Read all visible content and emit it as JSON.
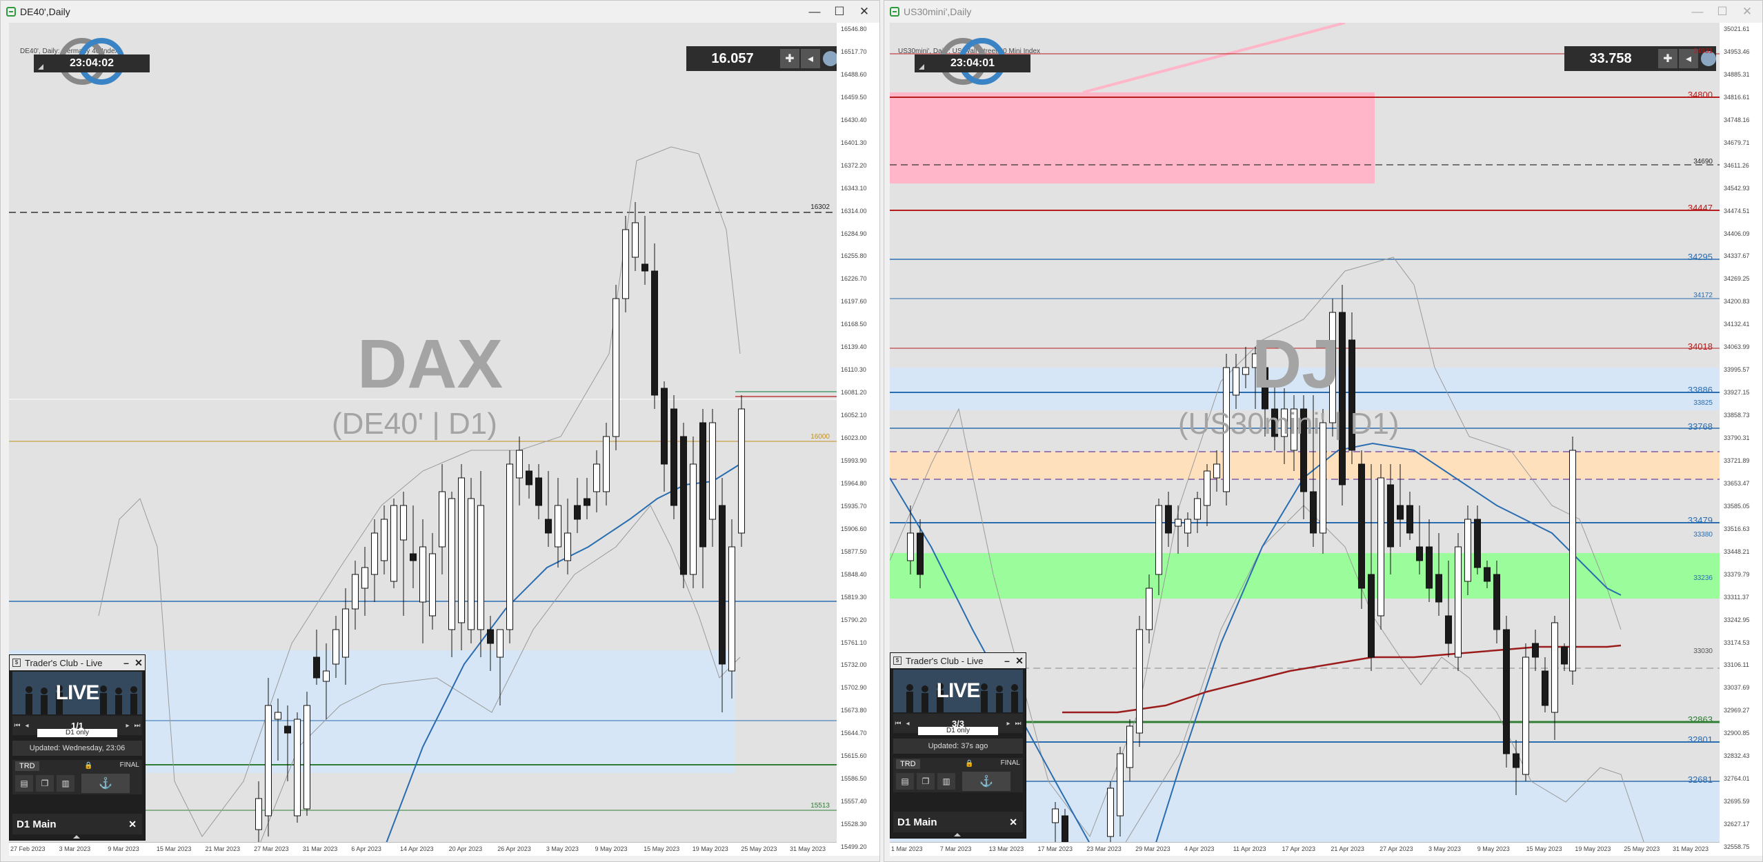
{
  "windows": [
    {
      "title": "DE40',Daily",
      "subtitle": "DE40', Daily:  Germany 40 Index",
      "watermark_main": "DAX",
      "watermark_sub": "(DE40' | D1)",
      "clock": "23:04:02",
      "price_box": "16.057",
      "y_axis_labels": [
        "16546.80",
        "16517.70",
        "16488.60",
        "16459.50",
        "16430.40",
        "16401.30",
        "16372.20",
        "16343.10",
        "16314.00",
        "16284.90",
        "16255.80",
        "16226.70",
        "16197.60",
        "16168.50",
        "16139.40",
        "16110.30",
        "16081.20",
        "16052.10",
        "16023.00",
        "15993.90",
        "15964.80",
        "15935.70",
        "15906.60",
        "15877.50",
        "15848.40",
        "15819.30",
        "15790.20",
        "15761.10",
        "15732.00",
        "15702.90",
        "15673.80",
        "15644.70",
        "15615.60",
        "15586.50",
        "15557.40",
        "15528.30",
        "15499.20"
      ],
      "x_axis_labels": [
        "27 Feb 2023",
        "3 Mar 2023",
        "9 Mar 2023",
        "15 Mar 2023",
        "21 Mar 2023",
        "27 Mar 2023",
        "31 Mar 2023",
        "6 Apr 2023",
        "14 Apr 2023",
        "20 Apr 2023",
        "26 Apr 2023",
        "3 May 2023",
        "9 May 2023",
        "15 May 2023",
        "19 May 2023",
        "25 May 2023",
        "31 May 2023"
      ],
      "level_labels": [
        {
          "text": "16302",
          "color": "#222222"
        },
        {
          "text": "16000",
          "color": "#c09020"
        },
        {
          "text": "15513",
          "color": "#2e7d32"
        }
      ],
      "panel": {
        "title": "Trader's Club - Live",
        "live": "LIVE",
        "page": "1/1",
        "filter": "D1 only",
        "updated": "Updated: Wednesday, 23:06",
        "trd": "TRD",
        "final": "FINAL",
        "d1_main": "D1 Main"
      }
    },
    {
      "title": "US30mini',Daily",
      "subtitle": "US30mini', Daily:  US Wall Street 30 Mini Index",
      "watermark_main": "DJ",
      "watermark_sub": "(US30mini' | D1)",
      "clock": "23:04:01",
      "price_box": "33.758",
      "y_axis_labels": [
        "35021.61",
        "34953.46",
        "34885.31",
        "34816.61",
        "34748.16",
        "34679.71",
        "34611.26",
        "34542.93",
        "34474.51",
        "34406.09",
        "34337.67",
        "34269.25",
        "34200.83",
        "34132.41",
        "34063.99",
        "33995.57",
        "33927.15",
        "33858.73",
        "33790.31",
        "33721.89",
        "33653.47",
        "33585.05",
        "33516.63",
        "33448.21",
        "33379.79",
        "33311.37",
        "33242.95",
        "33174.53",
        "33106.11",
        "33037.69",
        "32969.27",
        "32900.85",
        "32832.43",
        "32764.01",
        "32695.59",
        "32627.17",
        "32558.75"
      ],
      "x_axis_labels": [
        "1 Mar 2023",
        "7 Mar 2023",
        "13 Mar 2023",
        "17 Mar 2023",
        "23 Mar 2023",
        "29 Mar 2023",
        "4 Apr 2023",
        "11 Apr 2023",
        "17 Apr 2023",
        "21 Apr 2023",
        "27 Apr 2023",
        "3 May 2023",
        "9 May 2023",
        "15 May 2023",
        "19 May 2023",
        "25 May 2023",
        "31 May 2023"
      ],
      "level_labels": [
        {
          "text": "34931",
          "color": "#b71c1c"
        },
        {
          "text": "34800",
          "color": "#b71c1c"
        },
        {
          "text": "34690",
          "color": "#222222"
        },
        {
          "text": "34447",
          "color": "#b71c1c"
        },
        {
          "text": "34295",
          "color": "#2a6cb0"
        },
        {
          "text": "34172",
          "color": "#2a6cb0"
        },
        {
          "text": "34018",
          "color": "#b71c1c"
        },
        {
          "text": "33886",
          "color": "#2a6cb0"
        },
        {
          "text": "33825",
          "color": "#2a6cb0"
        },
        {
          "text": "33768",
          "color": "#2a6cb0"
        },
        {
          "text": "33479",
          "color": "#2a6cb0"
        },
        {
          "text": "33380",
          "color": "#2a6cb0"
        },
        {
          "text": "33236",
          "color": "#2a6cb0"
        },
        {
          "text": "33030",
          "color": "#555555"
        },
        {
          "text": "32863",
          "color": "#2e7d32"
        },
        {
          "text": "32801",
          "color": "#2a6cb0"
        },
        {
          "text": "32681",
          "color": "#2a6cb0"
        }
      ],
      "panel": {
        "title": "Trader's Club - Live",
        "live": "LIVE",
        "page": "3/3",
        "filter": "D1 only",
        "updated": "Updated: 37s ago",
        "trd": "TRD",
        "final": "FINAL",
        "d1_main": "D1 Main"
      }
    }
  ],
  "window_buttons": {
    "minimize": "—",
    "maximize": "☐",
    "close": "✕"
  },
  "colors": {
    "chart_bg": "#e2e2e2",
    "dax_fill": "#b0b0b0",
    "ema_blue": "#2a6cb0",
    "sma_red": "#9b1c1c",
    "zone_red": "#ffb6c8",
    "zone_orange": "#ffe0bd",
    "zone_green": "#9afc9a",
    "zone_blue": "#d6e6f6"
  }
}
